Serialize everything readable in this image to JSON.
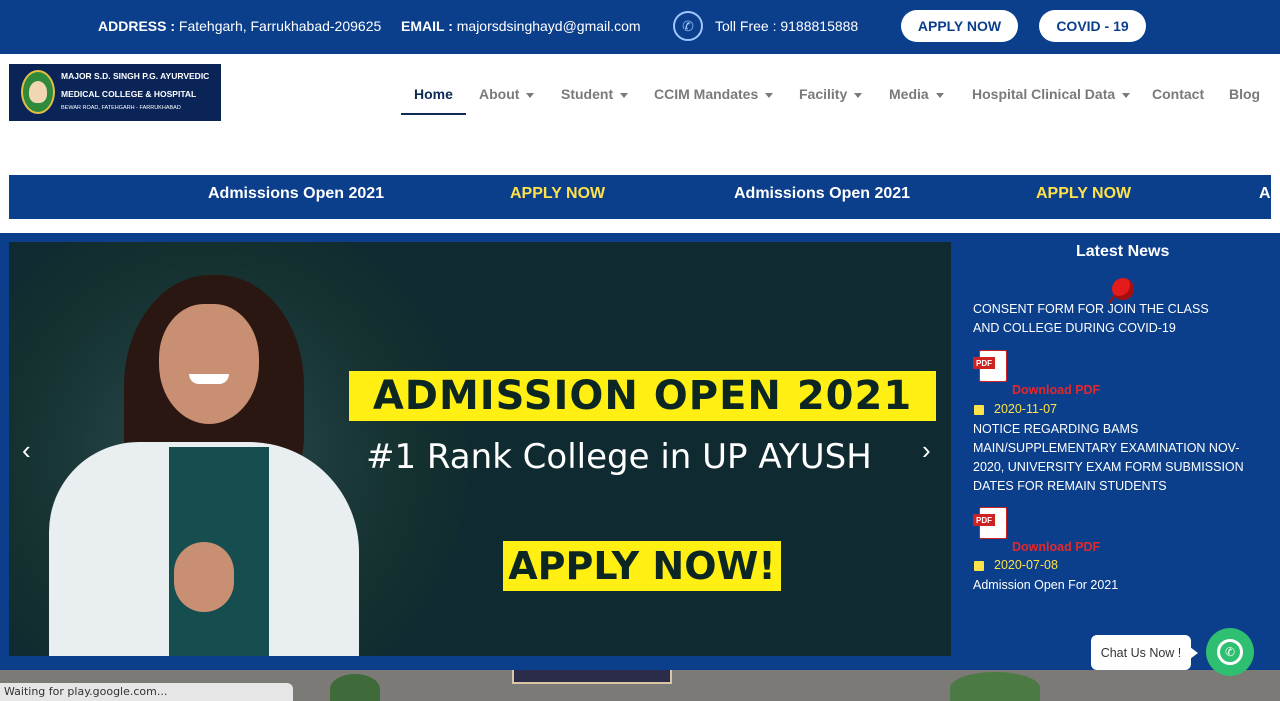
{
  "topbar": {
    "address_label": "ADDRESS :",
    "address_value": "Fatehgarh, Farrukhabad-209625",
    "email_label": "EMAIL :",
    "email_value": "majorsdsinghayd@gmail.com",
    "tollfree": "Toll Free : 9188815888",
    "apply_label": "APPLY NOW",
    "covid_label": "COVID - 19"
  },
  "logo": {
    "line1": "MAJOR S.D. SINGH P.G. AYURVEDIC",
    "line2": "MEDICAL COLLEGE & HOSPITAL",
    "line3": "BEWAR ROAD, FATEHGARH - FARRUKHABAD"
  },
  "nav": {
    "items": [
      {
        "label": "Home"
      },
      {
        "label": "About"
      },
      {
        "label": "Student"
      },
      {
        "label": "CCIM Mandates"
      },
      {
        "label": "Facility"
      },
      {
        "label": "Media"
      },
      {
        "label": "Hospital Clinical Data"
      },
      {
        "label": "Contact"
      },
      {
        "label": "Blog"
      }
    ]
  },
  "marquee": {
    "items": [
      "Admissions Open 2021",
      "APPLY NOW",
      "Admissions Open 2021",
      "APPLY NOW",
      "Ad"
    ]
  },
  "slider": {
    "headline": "ADMISSION OPEN 2021",
    "rank": "#1 Rank College in UP AYUSH",
    "cta": "APPLY NOW!",
    "prev": "‹",
    "next": "›"
  },
  "news": {
    "title": "Latest News",
    "items": [
      {
        "text": "CONSENT FORM FOR JOIN THE CLASS AND COLLEGE DURING COVID-19"
      },
      {
        "pdf_tag": "PDF",
        "download": "Download PDF",
        "date": "2020-11-07",
        "text": "NOTICE REGARDING BAMS MAIN/SUPPLEMENTARY EXAMINATION NOV-2020, UNIVERSITY EXAM FORM SUBMISSION DATES FOR REMAIN STUDENTS"
      },
      {
        "pdf_tag": "PDF",
        "download": "Download PDF",
        "date": "2020-07-08",
        "text": "Admission Open For 2021"
      }
    ]
  },
  "chat": {
    "label": "Chat Us Now !"
  },
  "status": {
    "text": "Waiting for play.google.com..."
  },
  "colors": {
    "brand_blue": "#0b3f8c",
    "accent_yellow": "#ffef13",
    "whatsapp_green": "#2fbf71"
  }
}
